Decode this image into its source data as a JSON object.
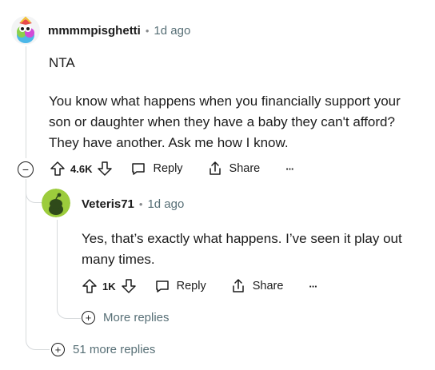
{
  "comment": {
    "username": "mmmmpisghetti",
    "separator": "•",
    "time": "1d ago",
    "paragraphs": [
      "NTA",
      "You know what happens when you financially support your son or daughter when they have a baby they can't afford? They have another. Ask me how I know."
    ],
    "votes": "4.6K",
    "reply_label": "Reply",
    "share_label": "Share",
    "more_label": "···",
    "collapse_symbol": "−"
  },
  "reply": {
    "username": "Veteris71",
    "separator": "•",
    "time": "1d ago",
    "text": "Yes, that’s exactly what happens. I’ve seen it play out many times.",
    "votes": "1K",
    "reply_label": "Reply",
    "share_label": "Share",
    "more_label": "···",
    "more_replies": "More replies"
  },
  "thread": {
    "more_replies": "51 more replies",
    "plus_symbol": "+"
  },
  "colors": {
    "reply_avatar": "#9ccc3c",
    "thread_line": "#d7dadc"
  }
}
